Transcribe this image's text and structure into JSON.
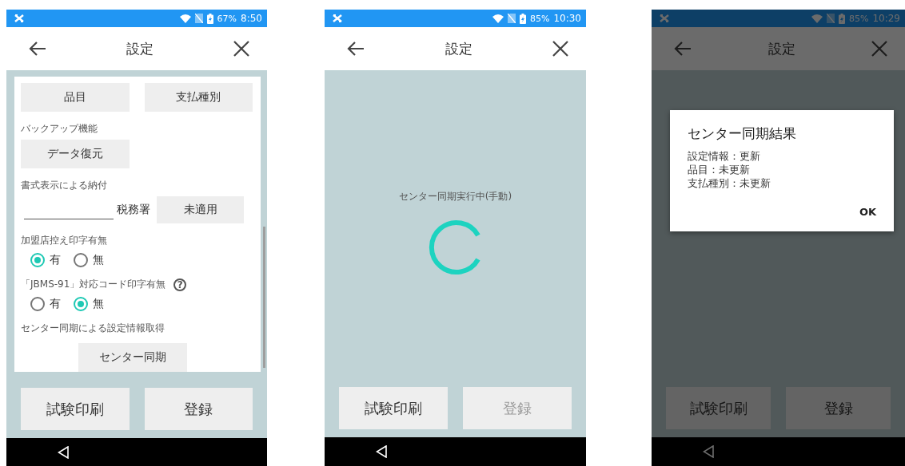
{
  "screens": [
    {
      "kind": "settings",
      "status_bar": {
        "battery": "67%",
        "time": "8:50"
      },
      "header": {
        "title": "設定"
      },
      "sections": [
        {
          "kind": "button_row",
          "buttons": [
            "品目",
            "支払種別"
          ]
        },
        {
          "kind": "heading",
          "text": "バックアップ機能"
        },
        {
          "kind": "button_row",
          "buttons": [
            "データ復元"
          ]
        },
        {
          "kind": "heading",
          "text": "書式表示による納付"
        },
        {
          "kind": "field_row",
          "suffix": "税務署",
          "button": "未適用"
        },
        {
          "kind": "heading",
          "text": "加盟店控え印字有無"
        },
        {
          "kind": "radio",
          "options": [
            {
              "label": "有",
              "selected": true
            },
            {
              "label": "無",
              "selected": false
            }
          ]
        },
        {
          "kind": "heading",
          "text": "「JBMS-91」対応コード印字有無",
          "help": "?"
        },
        {
          "kind": "radio",
          "options": [
            {
              "label": "有",
              "selected": false
            },
            {
              "label": "無",
              "selected": true
            }
          ]
        },
        {
          "kind": "heading",
          "text": "センター同期による設定情報取得"
        },
        {
          "kind": "center_button",
          "label": "センター同期"
        }
      ],
      "footer_buttons": [
        {
          "label": "試験印刷",
          "disabled": false
        },
        {
          "label": "登録",
          "disabled": false
        }
      ]
    },
    {
      "kind": "loading",
      "status_bar": {
        "battery": "85%",
        "time": "10:30"
      },
      "header": {
        "title": "設定"
      },
      "message": "センター同期実行中(手動)",
      "footer_buttons": [
        {
          "label": "試験印刷",
          "disabled": false
        },
        {
          "label": "登録",
          "disabled": true
        }
      ]
    },
    {
      "kind": "dialog",
      "status_bar": {
        "battery": "85%",
        "time": "10:29"
      },
      "header": {
        "title": "設定"
      },
      "dialog": {
        "title": "センター同期結果",
        "lines": [
          "設定情報：更新",
          "品目：未更新",
          "支払種別：未更新"
        ],
        "button": "OK"
      },
      "footer_buttons": [
        {
          "label": "試験印刷",
          "disabled": false
        },
        {
          "label": "登録",
          "disabled": false
        }
      ]
    }
  ]
}
